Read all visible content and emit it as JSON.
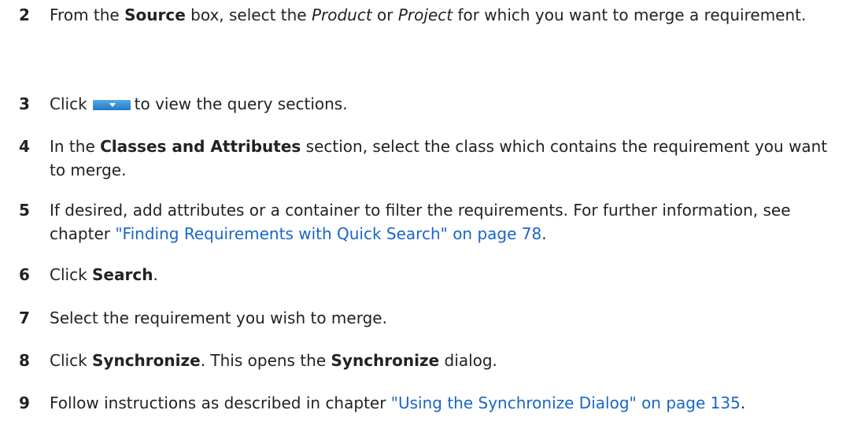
{
  "steps": [
    {
      "number": "2",
      "t1": "From the ",
      "b1": "Source",
      "t2": " box, select the ",
      "i1": "Product",
      "t3": " or ",
      "i2": "Project",
      "t4": " for which you want to merge a requirement."
    },
    {
      "number": "3",
      "t1": "Click",
      "button_icon": "dropdown-arrow-button-icon",
      "t2": "to view the query sections."
    },
    {
      "number": "4",
      "t1": "In the ",
      "b1": "Classes and Attributes",
      "t2": " section, select the class which contains the requirement you want to merge."
    },
    {
      "number": "5",
      "t1": "If desired, add attributes or a container to filter the requirements. For further information, see chapter ",
      "link": "\"Finding Requirements with Quick Search\" on page 78",
      "t2": "."
    },
    {
      "number": "6",
      "t1": "Click ",
      "b1": "Search",
      "t2": "."
    },
    {
      "number": "7",
      "t1": "Select the requirement you wish to merge."
    },
    {
      "number": "8",
      "t1": "Click ",
      "b1": "Synchronize",
      "t2": ". This opens the ",
      "b2": "Synchronize",
      "t3": " dialog."
    },
    {
      "number": "9",
      "t1": "Follow instructions as described in chapter ",
      "link": "\"Using the Synchronize Dialog\" on page 135",
      "t2": "."
    }
  ],
  "colors": {
    "text": "#222222",
    "link": "#1a66c9",
    "button": "#2f8ad6"
  }
}
